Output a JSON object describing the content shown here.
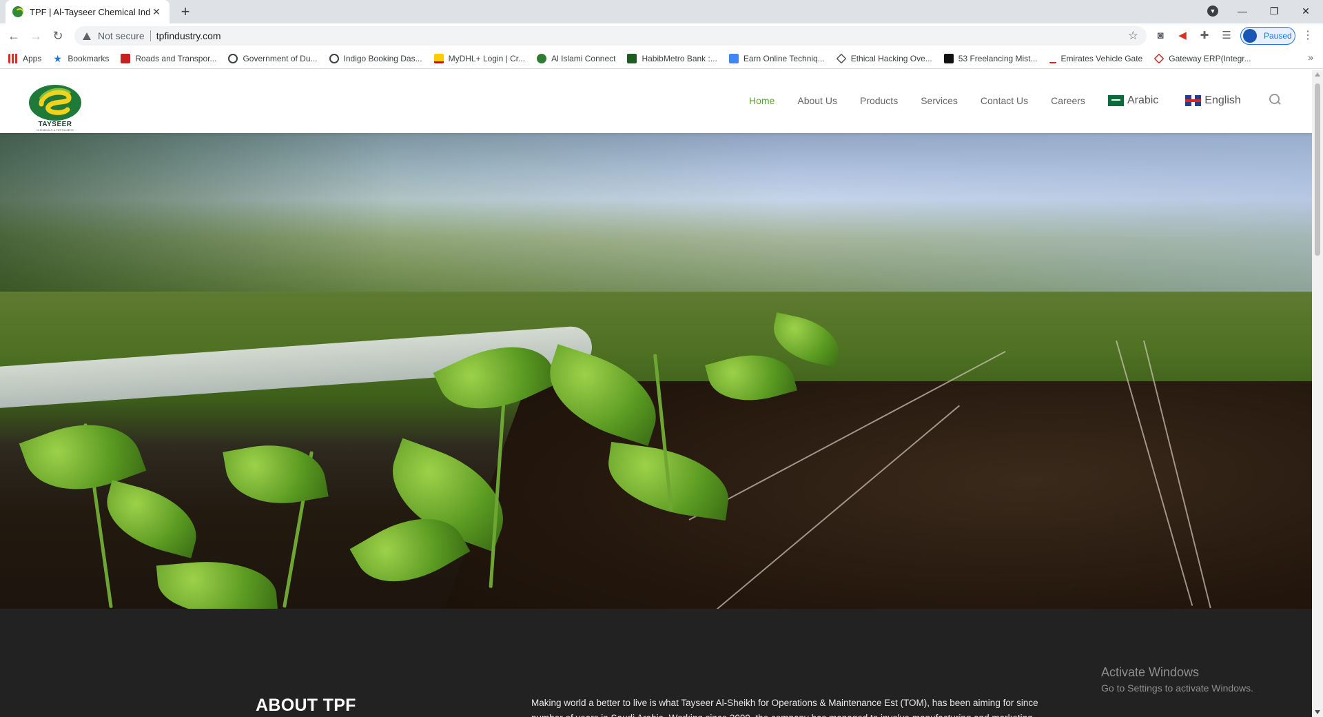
{
  "browser": {
    "tab_title": "TPF | Al-Tayseer Chemical Industr",
    "new_tab": "+",
    "tab_close": "✕",
    "url_security": "Not secure",
    "url": "tpfindustry.com",
    "profile_label": "Paused",
    "bookmarks": [
      {
        "label": "Apps",
        "icon_color": "#d93025"
      },
      {
        "label": "Bookmarks",
        "icon_color": "#1a73e8"
      },
      {
        "label": "Roads and Transpor...",
        "icon_color": "#c5221f"
      },
      {
        "label": "Government of Du...",
        "icon_color": "#3c4043"
      },
      {
        "label": "Indigo Booking Das...",
        "icon_color": "#3c4043"
      },
      {
        "label": "MyDHL+ Login | Cr...",
        "icon_color": "#ffcc00"
      },
      {
        "label": "Al Islami Connect",
        "icon_color": "#2e7d32"
      },
      {
        "label": "HabibMetro Bank :...",
        "icon_color": "#1b5e20"
      },
      {
        "label": "Earn Online Techniq...",
        "icon_color": "#4285f4"
      },
      {
        "label": "Ethical Hacking Ove...",
        "icon_color": "#555555"
      },
      {
        "label": "53 Freelancing Mist...",
        "icon_color": "#111111"
      },
      {
        "label": "Emirates Vehicle Gate",
        "icon_color": "#c62828"
      },
      {
        "label": "Gateway ERP(Integr...",
        "icon_color": "#c62828"
      }
    ],
    "bookmarks_more": "»"
  },
  "site": {
    "logo_text": "TAYSEER",
    "logo_subtext": "CHEMICALS & FERTILIZERS",
    "nav": [
      {
        "label": "Home",
        "active": true
      },
      {
        "label": "About Us",
        "active": false
      },
      {
        "label": "Products",
        "active": false
      },
      {
        "label": "Services",
        "active": false
      },
      {
        "label": "Contact Us",
        "active": false
      },
      {
        "label": "Careers",
        "active": false
      }
    ],
    "lang_arabic": "Arabic",
    "lang_english": "English",
    "accent_color": "#5fa035",
    "about_title": "ABOUT TPF",
    "about_text": "Making world a better to live is what Tayseer Al-Sheikh for Operations & Maintenance Est (TOM), has been aiming for since number of years in Saudi Arabia. Working since 2009, the company has managed to involve manufacturing and marketing."
  },
  "os_watermark": {
    "line1": "Activate Windows",
    "line2": "Go to Settings to activate Windows."
  }
}
